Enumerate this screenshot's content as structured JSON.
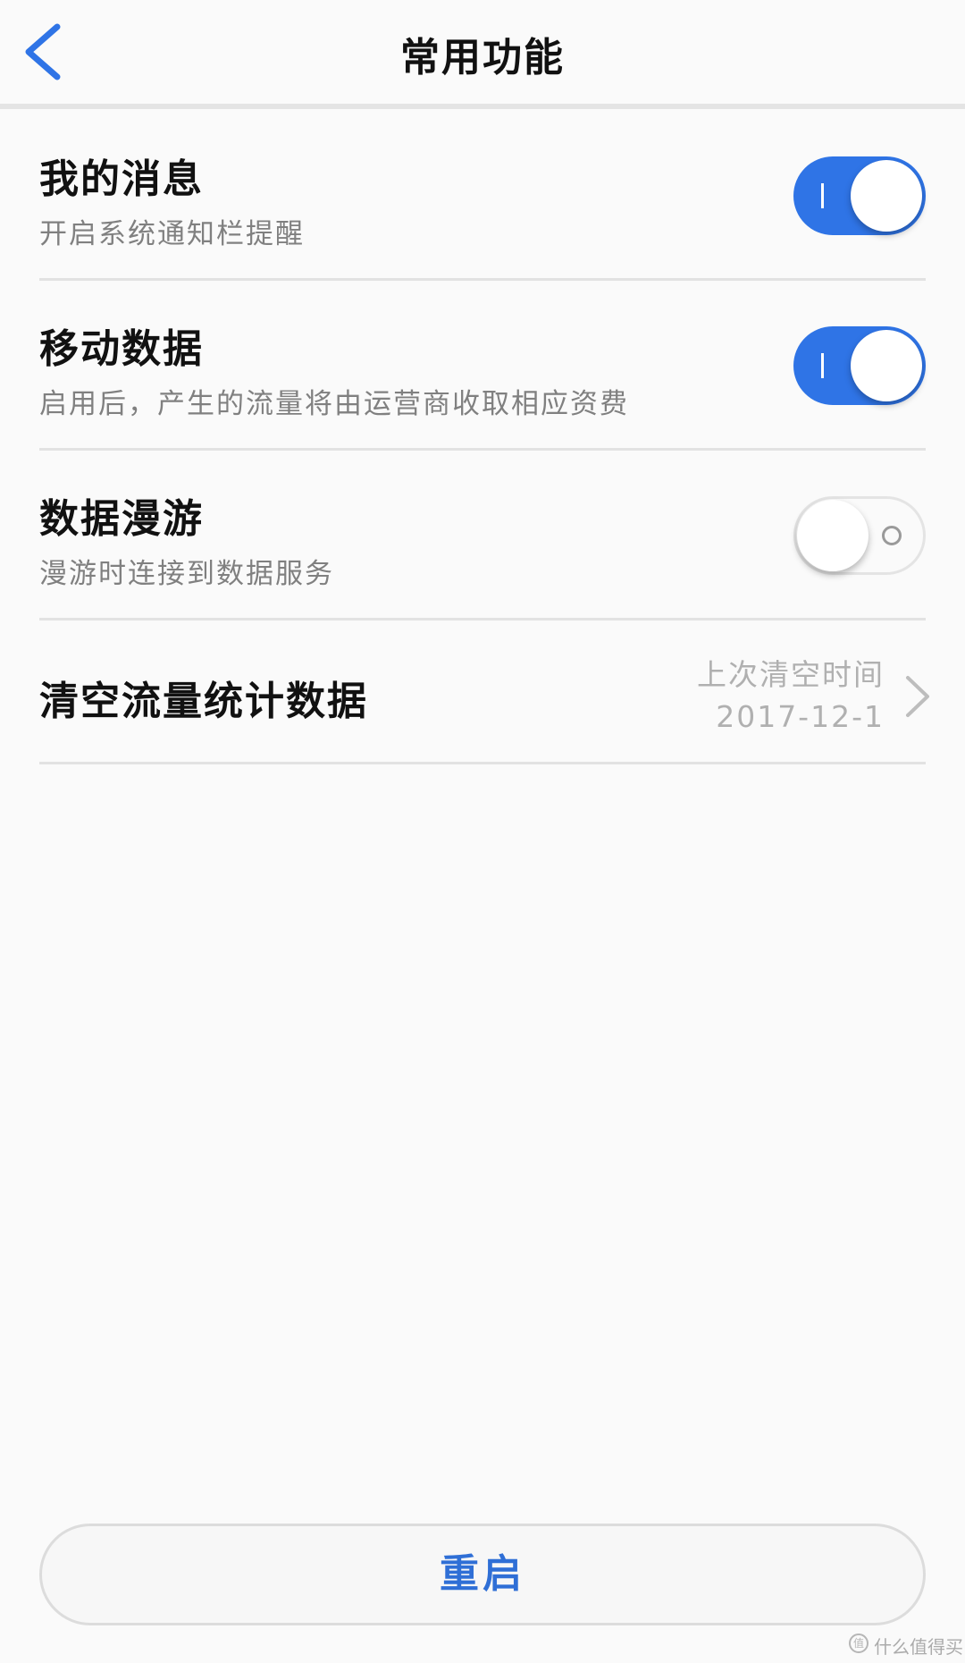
{
  "header": {
    "title": "常用功能",
    "back_icon": "chevron-left-icon",
    "accent_color": "#2f74e6"
  },
  "settings": [
    {
      "title": "我的消息",
      "subtitle": "开启系统通知栏提醒",
      "toggle": "on"
    },
    {
      "title": "移动数据",
      "subtitle": "启用后，产生的流量将由运营商收取相应资费",
      "toggle": "on"
    },
    {
      "title": "数据漫游",
      "subtitle": "漫游时连接到数据服务",
      "toggle": "off"
    }
  ],
  "clear_stats": {
    "title": "清空流量统计数据",
    "meta_label": "上次清空时间",
    "meta_value": "2017-12-1",
    "icon": "chevron-right-icon"
  },
  "restart_button": {
    "label": "重启"
  },
  "watermark": {
    "icon_glyph": "值",
    "text": "什么值得买"
  }
}
